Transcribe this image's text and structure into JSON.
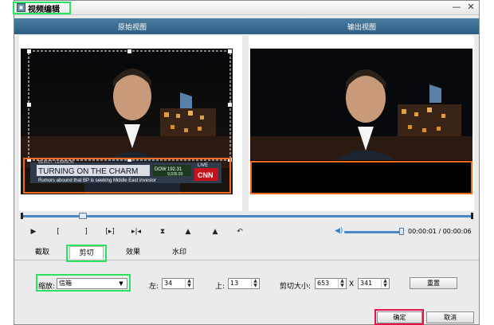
{
  "window": {
    "title": "视频编辑",
    "minimize": "—",
    "close": "✕"
  },
  "views": {
    "original": "原始视图",
    "output": "输出视图"
  },
  "overlay": {
    "banner": "TURNING ON THE CHARM",
    "ticker": "Rumors abound that BP is seeking Middle East investor",
    "dow_label": "DOW",
    "dow_value": "192.31",
    "dow_sub": "9,935.93",
    "location": "BEIRUT, LEBANON",
    "live": "LIVE",
    "network": "CNN"
  },
  "time_display": "00:00:01 / 00:00:06",
  "tabs": [
    {
      "label": "截取"
    },
    {
      "label": "剪切"
    },
    {
      "label": "效果"
    },
    {
      "label": "水印"
    }
  ],
  "crop": {
    "zoom_label": "缩放:",
    "zoom_value": "信箱",
    "left_label": "左:",
    "left_value": "34",
    "top_label": "上:",
    "top_value": "13",
    "size_label": "剪切大小:",
    "width_value": "653",
    "x_sep": "X",
    "height_value": "341",
    "reset": "重置"
  },
  "buttons": {
    "ok": "确定",
    "cancel": "取消"
  },
  "colors": {
    "highlight_green": "#28e35e",
    "highlight_red": "#e8124a",
    "crop_orange": "#f26a1b",
    "header_blue": "#3a6a8f"
  },
  "controls": [
    "play-icon",
    "mark-in-icon",
    "mark-out-icon",
    "goto-marks-icon",
    "next-frame-icon",
    "trim-icon",
    "split-icon",
    "rotate-left-icon",
    "rotate-right-icon",
    "undo-icon"
  ]
}
